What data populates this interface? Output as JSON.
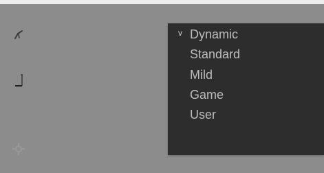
{
  "icons": {
    "left": [
      "brush-icon",
      "ruler-corner-icon",
      "settings-cluster-icon"
    ]
  },
  "menu": {
    "selected_index": 0,
    "checkmark": "v",
    "items": [
      {
        "label": "Dynamic"
      },
      {
        "label": "Standard"
      },
      {
        "label": "Mild"
      },
      {
        "label": "Game"
      },
      {
        "label": "User"
      }
    ]
  }
}
